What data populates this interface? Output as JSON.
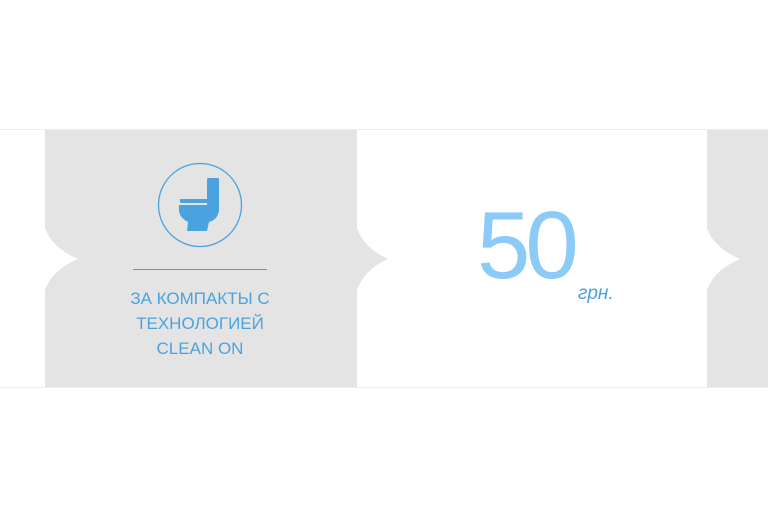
{
  "offer": {
    "line1": "ЗА КОМПАКТЫ С",
    "line2": "ТЕХНОЛОГИЕЙ",
    "line3": "CLEAN ON",
    "icon": "toilet-icon"
  },
  "price": {
    "value": "50",
    "unit": "грн."
  },
  "colors": {
    "panel_gray": "#e4e4e4",
    "accent_blue": "#4aa3df",
    "price_light_blue": "#8ccbf7"
  }
}
